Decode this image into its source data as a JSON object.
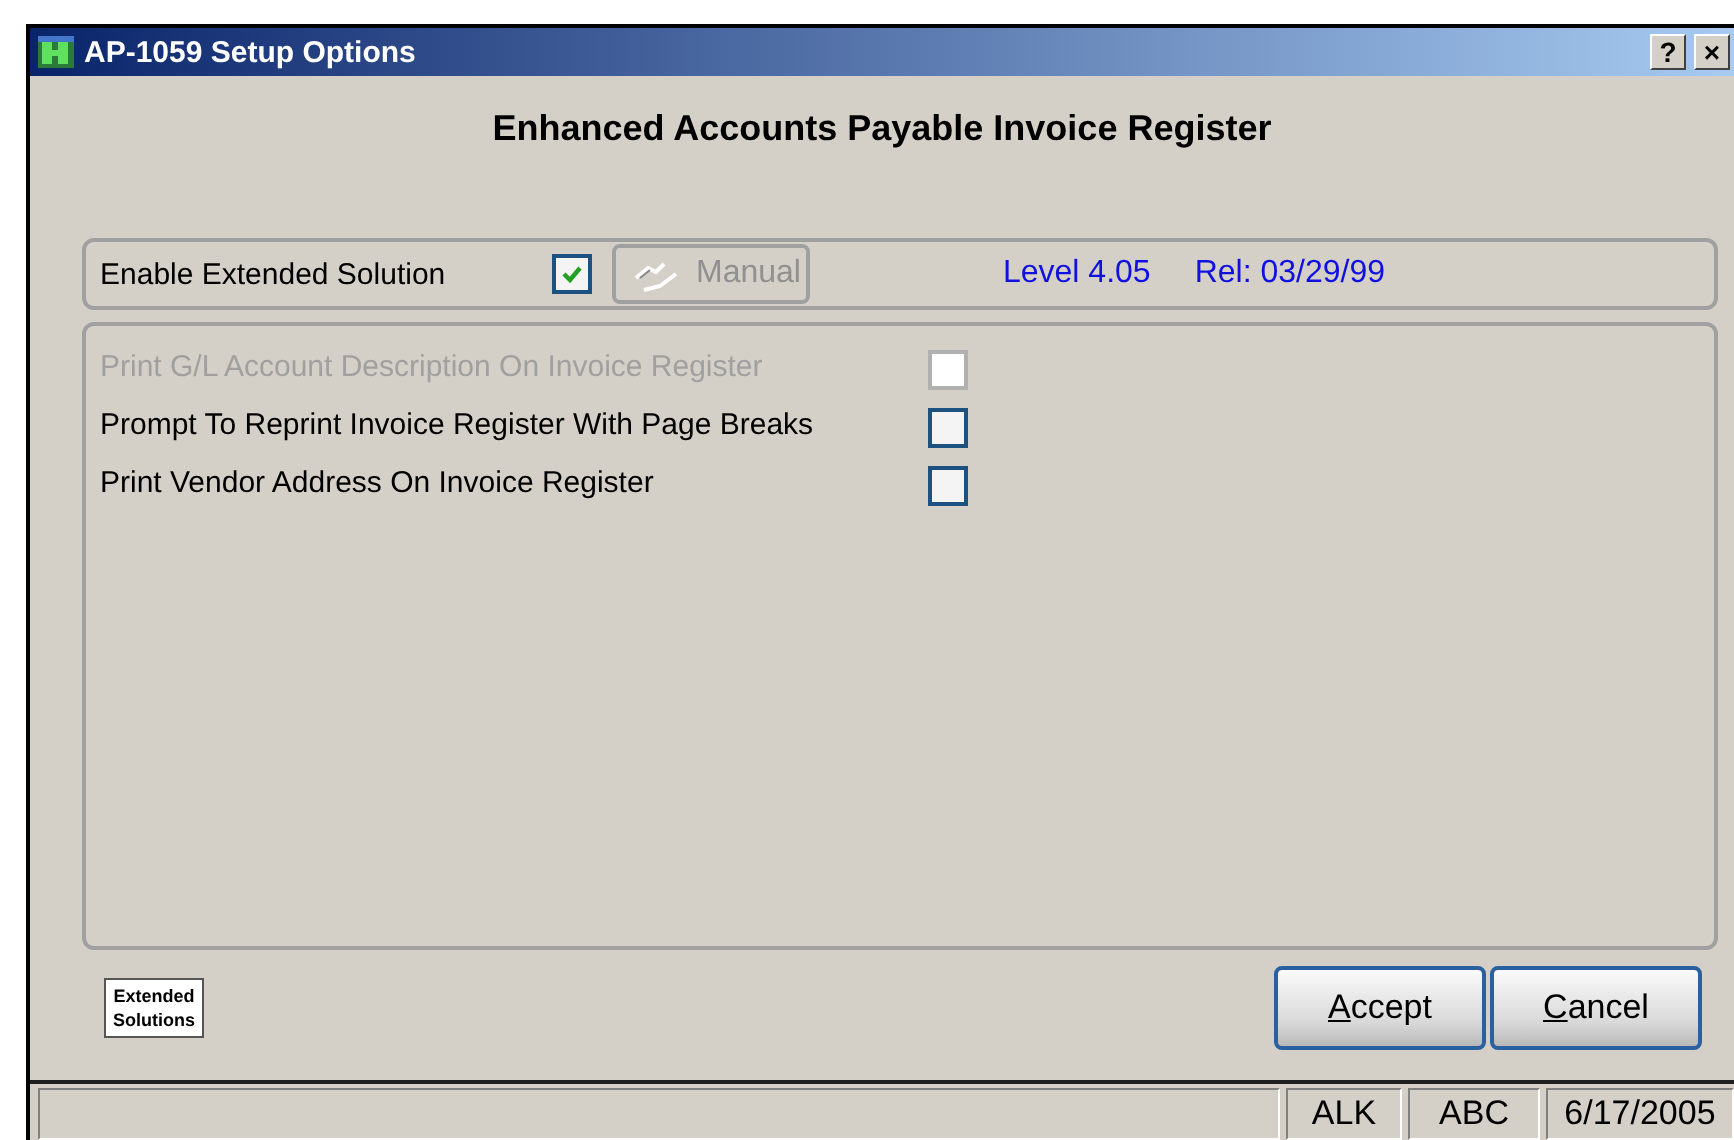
{
  "window": {
    "title": "AP-1059 Setup Options",
    "help_button": "?",
    "close_button": "×"
  },
  "heading": "Enhanced Accounts Payable Invoice Register",
  "solution": {
    "label": "Enable Extended Solution",
    "checked": true,
    "manual_button": {
      "label": "Manual",
      "disabled": true
    },
    "level": "Level 4.05",
    "release": "Rel: 03/29/99"
  },
  "options": [
    {
      "label": "Print G/L Account Description On Invoice Register",
      "checked": false,
      "disabled": true
    },
    {
      "label": "Prompt To Reprint Invoice Register With Page Breaks",
      "checked": false,
      "disabled": false
    },
    {
      "label": "Print Vendor Address On Invoice Register",
      "checked": false,
      "disabled": false
    }
  ],
  "logo": "Extended Solutions",
  "buttons": [
    {
      "label": "Accept"
    },
    {
      "label": "Cancel"
    }
  ],
  "status_bar": [
    "ALK",
    "ABC",
    "6/17/2005"
  ]
}
